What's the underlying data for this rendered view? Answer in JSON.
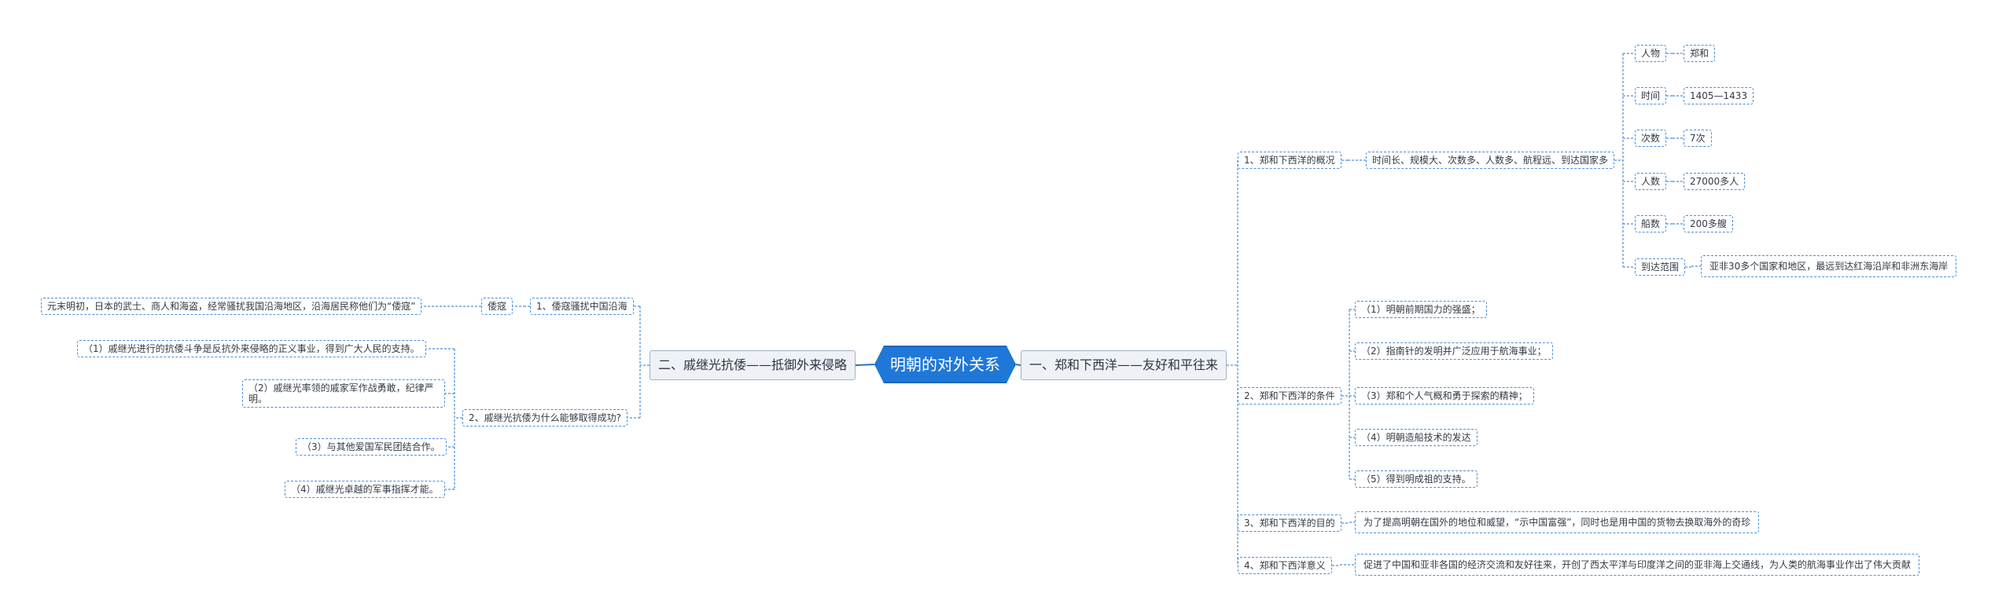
{
  "root": "明朝的对外关系",
  "colors": {
    "accent": "#1f78d8",
    "line": "#4a8fd6",
    "main_bg": "#eef2f7"
  },
  "right": {
    "title": "一、郑和下西洋——友好和平往来",
    "s1": {
      "label": "1、郑和下西洋的概况",
      "summary": "时间长、规模大、次数多、人数多、航程远、到达国家多",
      "items": [
        {
          "k": "人物",
          "v": "郑和"
        },
        {
          "k": "时间",
          "v": "1405—1433"
        },
        {
          "k": "次数",
          "v": "7次"
        },
        {
          "k": "人数",
          "v": "27000多人"
        },
        {
          "k": "船数",
          "v": "200多艘"
        },
        {
          "k": "到达范围",
          "v": "亚非30多个国家和地区，最远到达红海沿岸和非洲东海岸"
        }
      ]
    },
    "s2": {
      "label": "2、郑和下西洋的条件",
      "items": [
        "（1）明朝前期国力的强盛；",
        "（2）指南针的发明并广泛应用于航海事业；",
        "（3）郑和个人气概和勇于探索的精神；",
        "（4）明朝造船技术的发达",
        "（5）得到明成祖的支持。"
      ]
    },
    "s3": {
      "label": "3、郑和下西洋的目的",
      "text": "为了提高明朝在国外的地位和威望，“示中国富强”，同时也是用中国的货物去换取海外的奇珍"
    },
    "s4": {
      "label": "4、郑和下西洋意义",
      "text": "促进了中国和亚非各国的经济交流和友好往来，开创了西太平洋与印度洋之间的亚非海上交通线，为人类的航海事业作出了伟大贡献"
    }
  },
  "left": {
    "title": "二、戚继光抗倭——抵御外来侵略",
    "s1": {
      "label": "1、倭寇骚扰中国沿海",
      "term": "倭寇",
      "desc": "元末明初，日本的武士、商人和海盗，经常骚扰我国沿海地区，沿海居民称他们为“倭寇”"
    },
    "s2": {
      "label": "2、戚继光抗倭为什么能够取得成功?",
      "items": [
        "（1）戚继光进行的抗倭斗争是反抗外来侵略的正义事业，得到广大人民的支持。",
        "（2）戚继光率领的戚家军作战勇敢，纪律严明。",
        "（3）与其他爱国军民团结合作。",
        "（4）戚继光卓越的军事指挥才能。"
      ]
    }
  }
}
